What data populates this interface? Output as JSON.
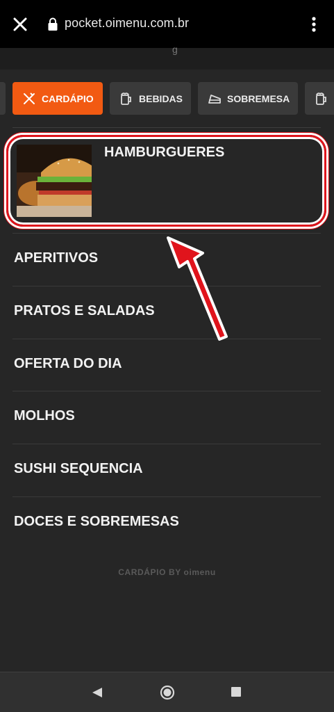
{
  "browser": {
    "url": "pocket.oimenu.com.br"
  },
  "tabs": [
    {
      "label": "CARDÁPIO",
      "icon": "utensils-icon",
      "active": true
    },
    {
      "label": "BEBIDAS",
      "icon": "beer-mug-icon",
      "active": false
    },
    {
      "label": "SOBREMESA",
      "icon": "cake-slice-icon",
      "active": false
    },
    {
      "label": "",
      "icon": "beer-mug-icon",
      "active": false
    }
  ],
  "categories": {
    "featured": {
      "label": "HAMBURGUERES",
      "image": "burger-photo"
    },
    "items": [
      {
        "label": "APERITIVOS"
      },
      {
        "label": "PRATOS E SALADAS"
      },
      {
        "label": "OFERTA DO DIA"
      },
      {
        "label": "MOLHOS"
      },
      {
        "label": "SUSHI SEQUENCIA"
      },
      {
        "label": "DOCES E SOBREMESAS"
      }
    ]
  },
  "footer": {
    "brand": "CARDÁPIO BY oimenu"
  },
  "colors": {
    "accent": "#f25a12",
    "background": "#262626",
    "tab_inactive": "#3a3a3a",
    "annotation": "#e0141c"
  }
}
